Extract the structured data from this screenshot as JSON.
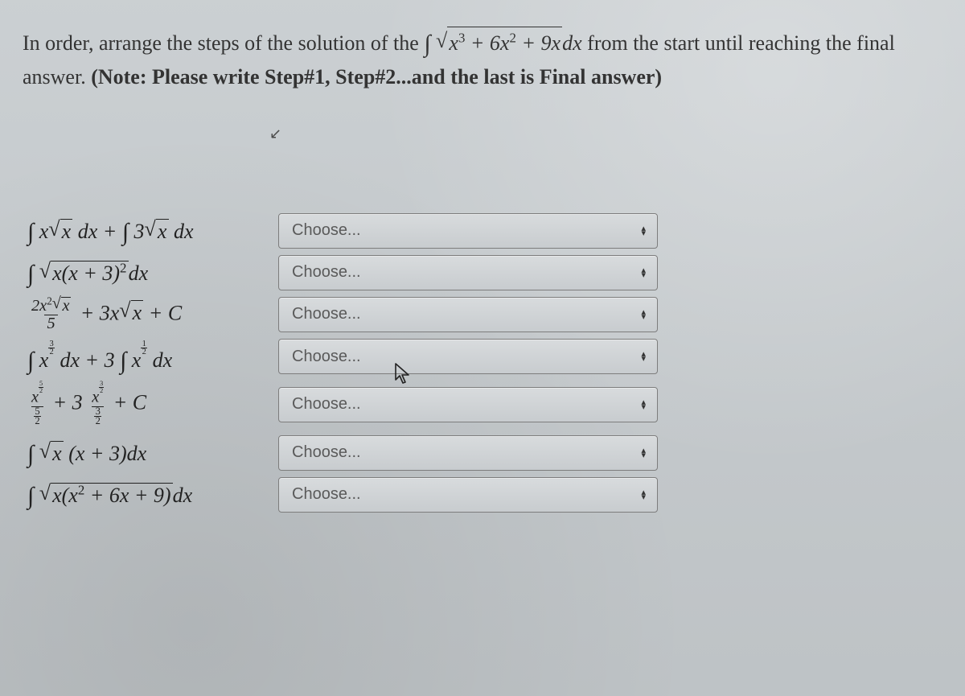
{
  "question": {
    "lead": "In order, arrange the steps of the solution of the ",
    "tail_1": " from the start until reaching the final answer.",
    "note": "(Note: Please write Step#1, Step#2...and the last is Final answer)"
  },
  "select_placeholder": "Choose...",
  "rows": [
    {
      "id": "row1"
    },
    {
      "id": "row2"
    },
    {
      "id": "row3"
    },
    {
      "id": "row4"
    },
    {
      "id": "row5"
    },
    {
      "id": "row6"
    },
    {
      "id": "row7"
    }
  ]
}
